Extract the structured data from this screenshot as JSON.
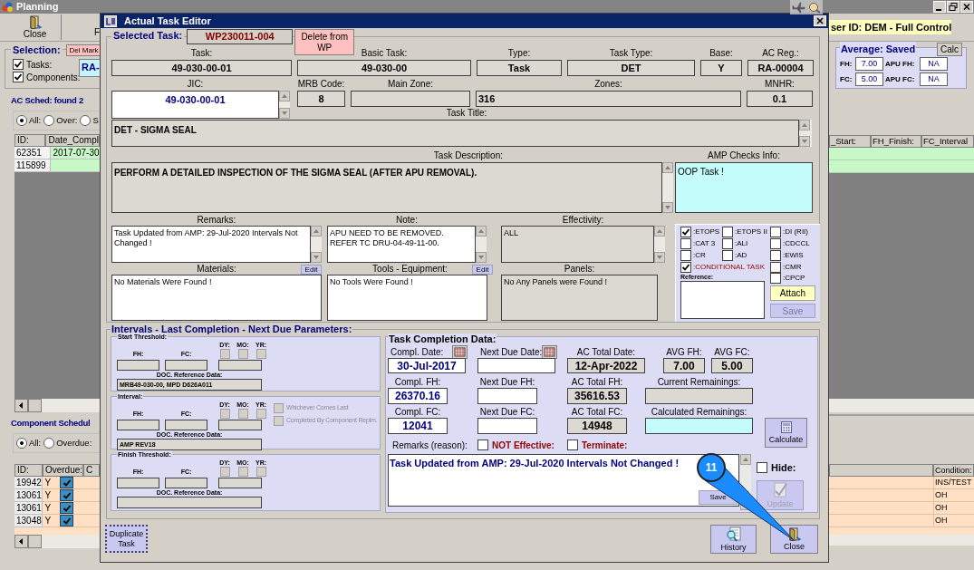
{
  "app": {
    "title": "Planning",
    "toolbar": [
      "Close",
      "F"
    ],
    "user_info": "ser ID: DEM - Full Control"
  },
  "selection": {
    "title": "Selection:",
    "del_mark": "Del Mark",
    "options": [
      {
        "label": "Tasks:",
        "checked": true
      },
      {
        "label": "Components:",
        "checked": true
      }
    ],
    "ac_reg": "RA-"
  },
  "average": {
    "title": "Average: Saved",
    "calc": "Calc",
    "fields": [
      {
        "label": "FH:",
        "value": "7.00"
      },
      {
        "label": "APU FH:",
        "value": "NA"
      },
      {
        "label": "FC:",
        "value": "5.00"
      },
      {
        "label": "APU FC:",
        "value": "NA"
      }
    ]
  },
  "ac_sched": {
    "title": "AC Sched: found 2",
    "filters": [
      {
        "label": "All:",
        "selected": true
      },
      {
        "label": "Over:",
        "selected": false
      },
      {
        "label": "S",
        "selected": false
      }
    ],
    "columns": [
      "ID:",
      "Date_Compl"
    ],
    "right_columns": [
      "_Start:",
      "FH_Finish:",
      "FC_Interval"
    ],
    "rows": [
      {
        "id": "62351",
        "date": "2017-07-30"
      },
      {
        "id": "115899"
      }
    ]
  },
  "component_schedule": {
    "title": "Component Schedul",
    "filters": [
      {
        "label": "All:",
        "selected": true
      },
      {
        "label": "Overdue:",
        "selected": false
      }
    ],
    "columns": [
      "ID:",
      "Overdue:",
      "C"
    ],
    "right_columns": [
      "Condition:"
    ],
    "rows": [
      {
        "id": "19942",
        "overdue": "Y",
        "checked": true,
        "condition": "INS/TEST"
      },
      {
        "id": "13061",
        "overdue": "Y",
        "checked": true,
        "condition": "OH"
      },
      {
        "id": "13061",
        "overdue": "Y",
        "checked": true,
        "condition": "OH"
      },
      {
        "id": "13048",
        "overdue": "Y",
        "checked": true,
        "condition": "OH"
      }
    ]
  },
  "dialog": {
    "title": "Actual Task Editor",
    "selected_task": {
      "title": "Selected Task:",
      "wp": "WP230011-004",
      "delete_button": "Delete from WP",
      "row1": [
        {
          "label": "Task:",
          "value": "49-030-00-01"
        },
        {
          "label": "Basic Task:",
          "value": "49-030-00"
        },
        {
          "label": "Type:",
          "value": "Task"
        },
        {
          "label": "Task Type:",
          "value": "DET"
        },
        {
          "label": "Base:",
          "value": "Y"
        },
        {
          "label": "AC Reg.:",
          "value": "RA-00004"
        }
      ],
      "jic": {
        "label": "JIC:",
        "value": "49-030-00-01"
      },
      "row2": [
        {
          "label": "MRB Code:",
          "value": "8"
        },
        {
          "label": "Main Zone:"
        },
        {
          "label": "Zones:",
          "value": "316"
        },
        {
          "label": "MNHR:",
          "value": "0.1"
        }
      ],
      "task_title": {
        "label": "Task Title:",
        "value": "DET - SIGMA SEAL"
      },
      "task_description": {
        "label": "Task Description:",
        "value": "PERFORM A DETAILED INSPECTION OF THE SIGMA SEAL (AFTER APU REMOVAL)."
      },
      "amp_checks_info": {
        "label": "AMP Checks Info:",
        "value": "OOP Task !"
      },
      "remarks": {
        "label": "Remarks:",
        "value": "Task Updated from AMP: 29-Jul-2020 Intervals Not Changed !"
      },
      "note": {
        "label": "Note:",
        "value": "APU NEED TO BE REMOVED. REFER TC DRU-04-49-11-00."
      },
      "effectivity": {
        "label": "Effectivity:",
        "value": "ALL"
      },
      "materials": {
        "label": "Materials:",
        "edit": "Edit",
        "value": "No Materials Were Found !"
      },
      "tools": {
        "label": "Tools - Equipment:",
        "edit": "Edit",
        "value": "No Tools Were Found !"
      },
      "panels": {
        "label": "Panels:",
        "value": "No Any Panels were Found !"
      },
      "flags": [
        {
          "label": ":ETOPS",
          "checked": true,
          "emphasized": false
        },
        {
          "label": ":ETOPS II",
          "checked": false,
          "emphasized": false
        },
        {
          "label": ":DI (RII)",
          "checked": false,
          "emphasized": false
        },
        {
          "label": ":CAT 3",
          "checked": false,
          "emphasized": false
        },
        {
          "label": ":ALI",
          "checked": false,
          "emphasized": false
        },
        {
          "label": ":CDCCL",
          "checked": false,
          "emphasized": false
        },
        {
          "label": ":CR",
          "checked": false,
          "emphasized": false
        },
        {
          "label": ":AD",
          "checked": false,
          "emphasized": false
        },
        {
          "label": ":EWIS",
          "checked": false,
          "emphasized": false
        },
        {
          "label": ":CONDITIONAL TASK",
          "checked": true,
          "emphasized": true
        },
        {
          "label": ":CMR",
          "checked": false,
          "emphasized": false
        },
        {
          "label": ":CPCP",
          "checked": false,
          "emphasized": false
        }
      ],
      "reference_label": "Reference:",
      "attach": "Attach",
      "save": {
        "label": "Save",
        "disabled": true
      }
    },
    "intervals": {
      "title": "Intervals - Last Completion - Next Due Parameters:",
      "thresholds": [
        {
          "title": "Start Threshold:",
          "period_labels": [
            "DY:",
            "MO:",
            "YR:"
          ],
          "period_checked": [
            false,
            false,
            false
          ],
          "fh_label": "FH:",
          "fc_label": "FC:",
          "doc_label": "DOC. Reference Data:",
          "doc": "MRB49-030-00, MPD D626A011"
        },
        {
          "title": "Interval:",
          "period_labels": [
            "DY:",
            "MO:",
            "YR:"
          ],
          "period_checked": [
            false,
            false,
            false
          ],
          "fh_label": "FH:",
          "fc_label": "FC:",
          "doc_label": "DOC. Reference Data:",
          "doc": "AMP REV18",
          "options": [
            {
              "label": "Whichever Comes Last",
              "checked": false,
              "disabled": true
            },
            {
              "label": "Completed By Component Replm.",
              "checked": false,
              "disabled": true
            }
          ]
        },
        {
          "title": "Finish Threshold:",
          "period_labels": [
            "DY:",
            "MO:",
            "YR:"
          ],
          "period_checked": [
            false,
            false,
            false
          ],
          "fh_label": "FH:",
          "fc_label": "FC:",
          "doc_label": "DOC. Reference Data:"
        }
      ]
    },
    "completion": {
      "title": "Task Completion Data:",
      "rows": [
        [
          {
            "label": "Compl. Date:",
            "value": "30-Jul-2017",
            "kind": "input",
            "calendar": true
          },
          {
            "label": "Next Due Date:",
            "kind": "input",
            "calendar": true
          },
          {
            "label": "AC Total Date:",
            "value": "12-Apr-2022",
            "kind": "readonly"
          },
          {
            "label": "AVG FH:",
            "value": "7.00",
            "kind": "readonly"
          },
          {
            "label": "AVG FC:",
            "value": "5.00",
            "kind": "readonly"
          }
        ],
        [
          {
            "label": "Compl. FH:",
            "value": "26370.16",
            "kind": "input"
          },
          {
            "label": "Next Due FH:",
            "kind": "input"
          },
          {
            "label": "AC Total FH:",
            "value": "35616.53",
            "kind": "readonly"
          },
          {
            "label": "Current Remainings:",
            "kind": "readonly"
          }
        ],
        [
          {
            "label": "Compl. FC:",
            "value": "12041",
            "kind": "input"
          },
          {
            "label": "Next Due FC:",
            "kind": "input"
          },
          {
            "label": "AC Total FC:",
            "value": "14948",
            "kind": "readonly"
          },
          {
            "label": "Calculated Remainings:",
            "kind": "result"
          }
        ]
      ],
      "calculate": "Calculate",
      "remarks_label": "Remarks (reason):",
      "not_effective": {
        "label": "NOT Effective:",
        "checked": false
      },
      "terminate": {
        "label": "Terminate:",
        "checked": false
      },
      "remarks": "Task Updated from AMP: 29-Jul-2020 Intervals Not Changed !",
      "save": "Save",
      "hide": {
        "label": "Hide:",
        "checked": false
      },
      "update": {
        "label": "Update",
        "disabled": true
      }
    },
    "buttons": {
      "duplicate": "Duplicate Task",
      "history": "History",
      "close": "Close"
    }
  },
  "annotation": {
    "label": "11"
  }
}
